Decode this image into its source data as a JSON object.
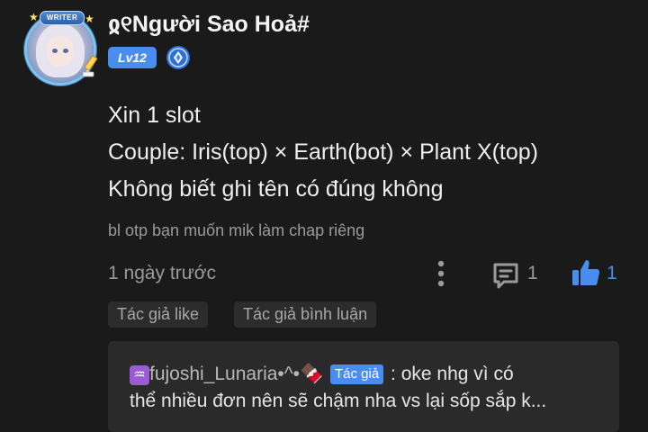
{
  "comment": {
    "author": {
      "name": "ჲ୧Người Sao Hoả#",
      "level": "Lv12",
      "badge_label": "WRITER",
      "avatar_icon": "avatar-image",
      "rank_icon": "rank-diamond-icon"
    },
    "content_lines": [
      "Xin 1 slot",
      "Couple: Iris(top) × Earth(bot) × Plant X(top)",
      "Không biết ghi tên có đúng không"
    ],
    "chapter_note": "bl otp bạn muốn mik làm chap riêng",
    "timestamp": "1 ngày trước",
    "actions": {
      "more_icon": "more-vertical-icon",
      "reply_icon": "comment-icon",
      "reply_count": "1",
      "like_icon": "thumbs-up-icon",
      "like_count": "1"
    },
    "tags": [
      "Tác giả like",
      "Tác giả bình luận"
    ],
    "reply": {
      "zodiac_icon": "♒",
      "author": "fujoshi_Lunaria•^•🍫",
      "author_tag": "Tác giả",
      "text_part1": ": oke nhg vì có",
      "text_part2": "thể nhiều đơn nên sẽ chậm nha vs lại sốp sắp k..."
    }
  },
  "colors": {
    "background": "#1a1a1a",
    "accent": "#4a8df0",
    "muted_text": "#9a9a9a",
    "tag_bg": "#2c2c2c",
    "reply_bg": "#2a2a2a"
  }
}
